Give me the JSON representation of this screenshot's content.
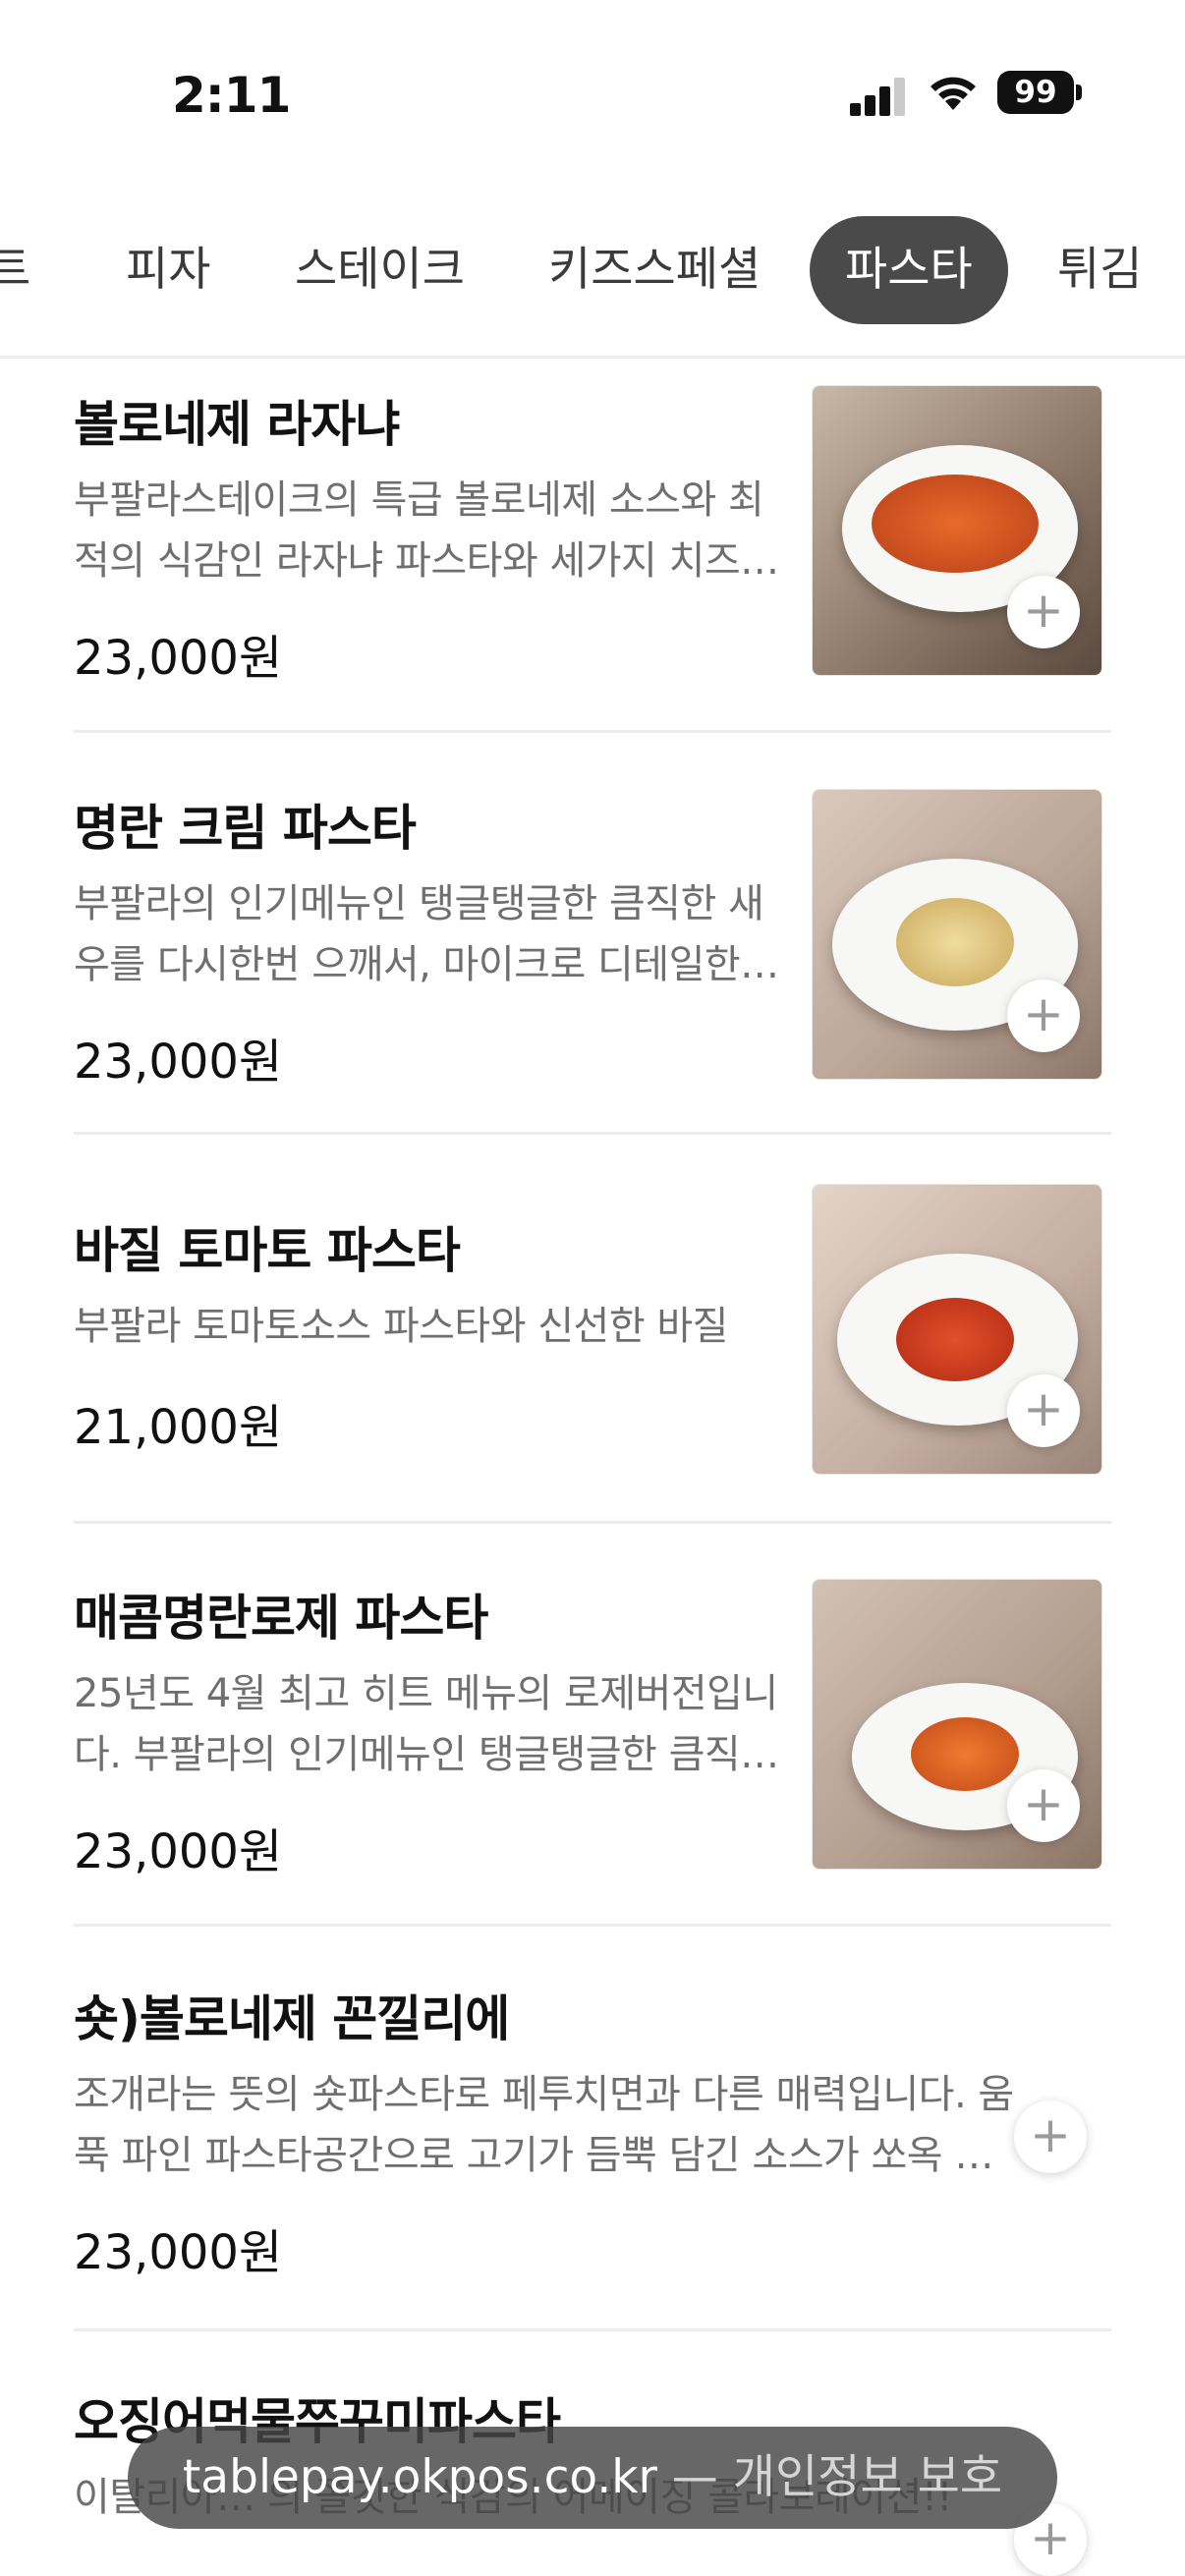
{
  "status_bar": {
    "time": "2:11",
    "battery": "99"
  },
  "tabs": [
    {
      "label": "트",
      "active": false
    },
    {
      "label": "피자",
      "active": false
    },
    {
      "label": "스테이크",
      "active": false
    },
    {
      "label": "키즈스페셜",
      "active": false
    },
    {
      "label": "파스타",
      "active": true
    },
    {
      "label": "튀김",
      "active": false
    }
  ],
  "menu": [
    {
      "name": "볼로네제 라자냐",
      "description": "부팔라스테이크의 특급 볼로네제 소스와 최적의 식감인 라자냐 파스타와 세가지 치즈…",
      "price": "23,000원",
      "add_label": "+"
    },
    {
      "name": "명란 크림 파스타",
      "description": "부팔라의 인기메뉴인 탱글탱글한 큼직한 새우를 다시한번 으깨서, 마이크로 디테일한…",
      "price": "23,000원",
      "add_label": "+"
    },
    {
      "name": "바질 토마토 파스타",
      "description": "부팔라 토마토소스 파스타와 신선한 바질",
      "price": "21,000원",
      "add_label": "+"
    },
    {
      "name": "매콤명란로제 파스타",
      "description": "25년도 4월 최고 히트 메뉴의 로제버전입니다. 부팔라의 인기메뉴인 탱글탱글한 큼직…",
      "price": "23,000원",
      "add_label": "+"
    },
    {
      "name": "숏)볼로네제 꼰낄리에",
      "description": "조개라는 뜻의 숏파스타로 페투치면과 다른 매력입니다. 움푹 파인 파스타공간으로 고기가 듬뿍 담긴 소스가 쏘옥 …",
      "price": "23,000원",
      "add_label": "+"
    },
    {
      "name": "오징어먹물쭈꾸미파스타",
      "description": "이탈리아… 의 쫄깃한 식감의 어메이징 콜라보레이션!!",
      "price": "",
      "add_label": "+"
    }
  ],
  "url_bar": {
    "domain": "tablepay.okpos.co.kr",
    "suffix": "— 개인정보 보호"
  },
  "colors": {
    "active_tab": "#4a4a4a",
    "price": "#111111",
    "description": "#6f6f6f",
    "divider": "#ececec"
  }
}
